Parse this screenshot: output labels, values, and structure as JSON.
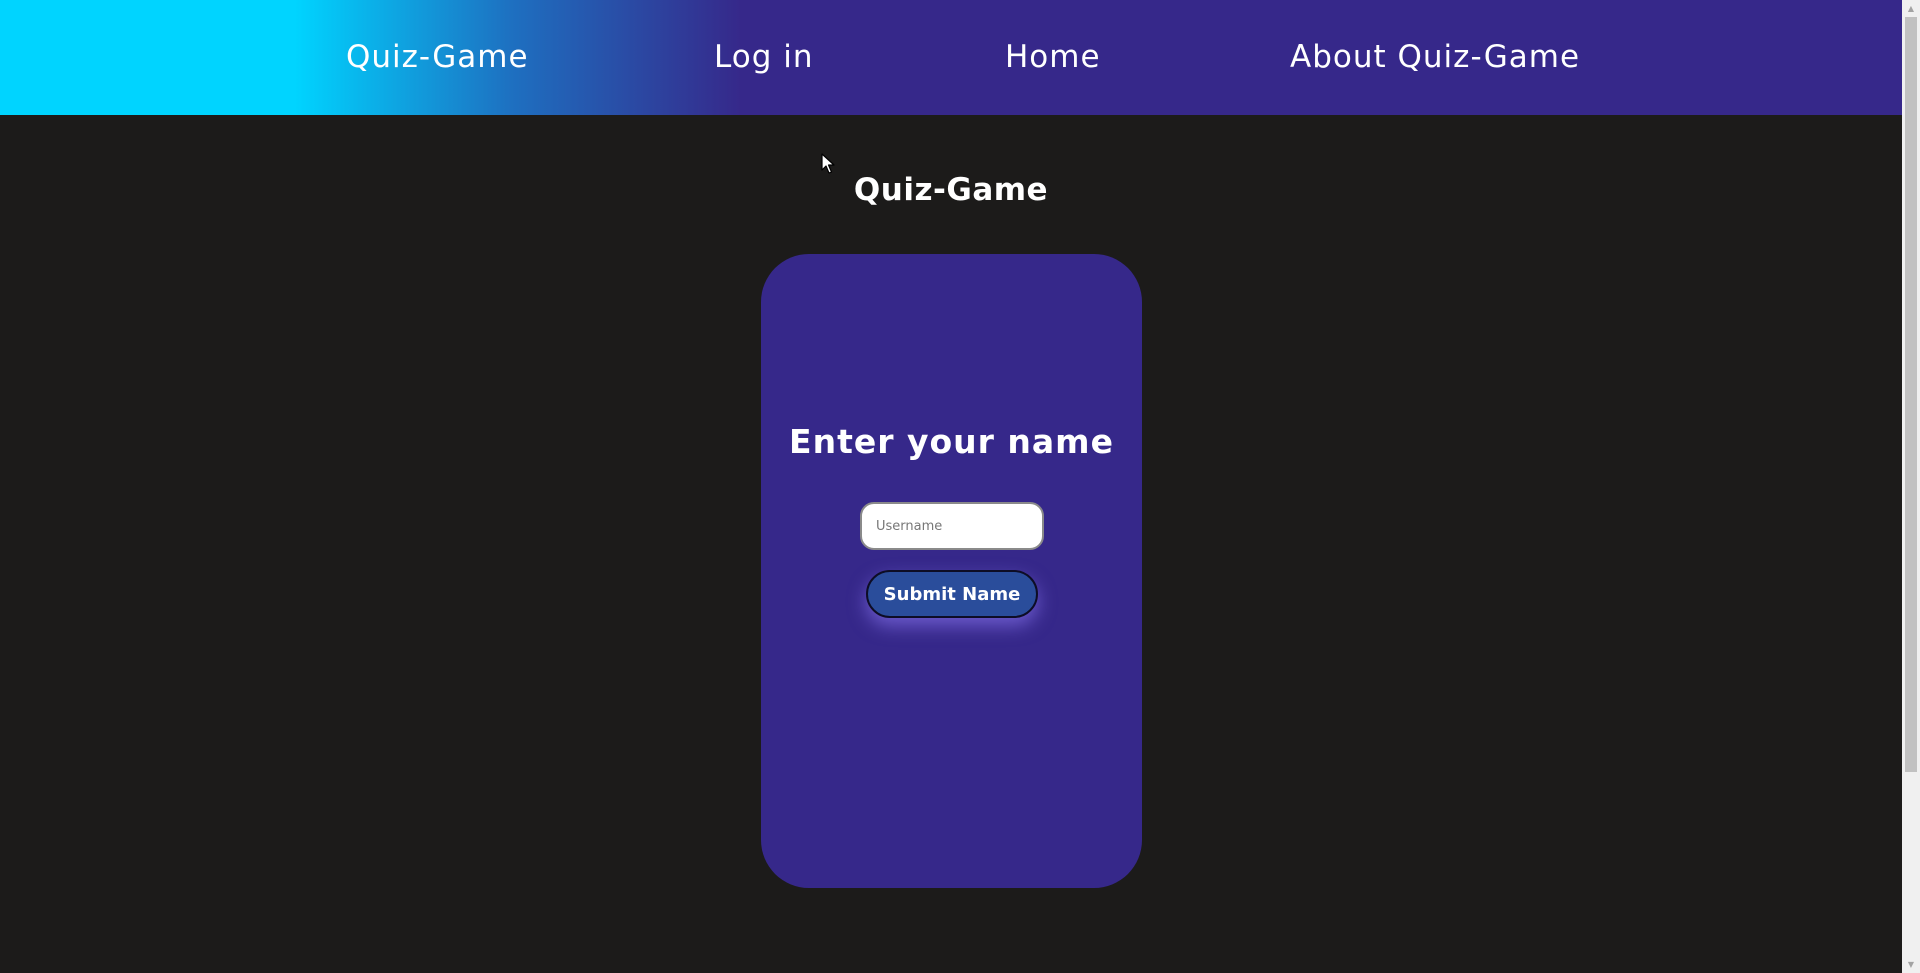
{
  "nav": {
    "brand": "Quiz-Game",
    "login": "Log in",
    "home": "Home",
    "about": "About Quiz-Game"
  },
  "main": {
    "title": "Quiz-Game"
  },
  "card": {
    "heading": "Enter your name",
    "input_placeholder": "Username",
    "input_value": "",
    "submit_label": "Submit Name"
  },
  "colors": {
    "background": "#1c1b1a",
    "nav_gradient_start": "#00d4ff",
    "nav_gradient_end": "#36288a",
    "card": "#36288a",
    "button": "#2a4d9b"
  },
  "icons": {
    "scroll_up": "triangle-up-icon",
    "scroll_down": "triangle-down-icon",
    "cursor": "mouse-pointer-icon"
  }
}
